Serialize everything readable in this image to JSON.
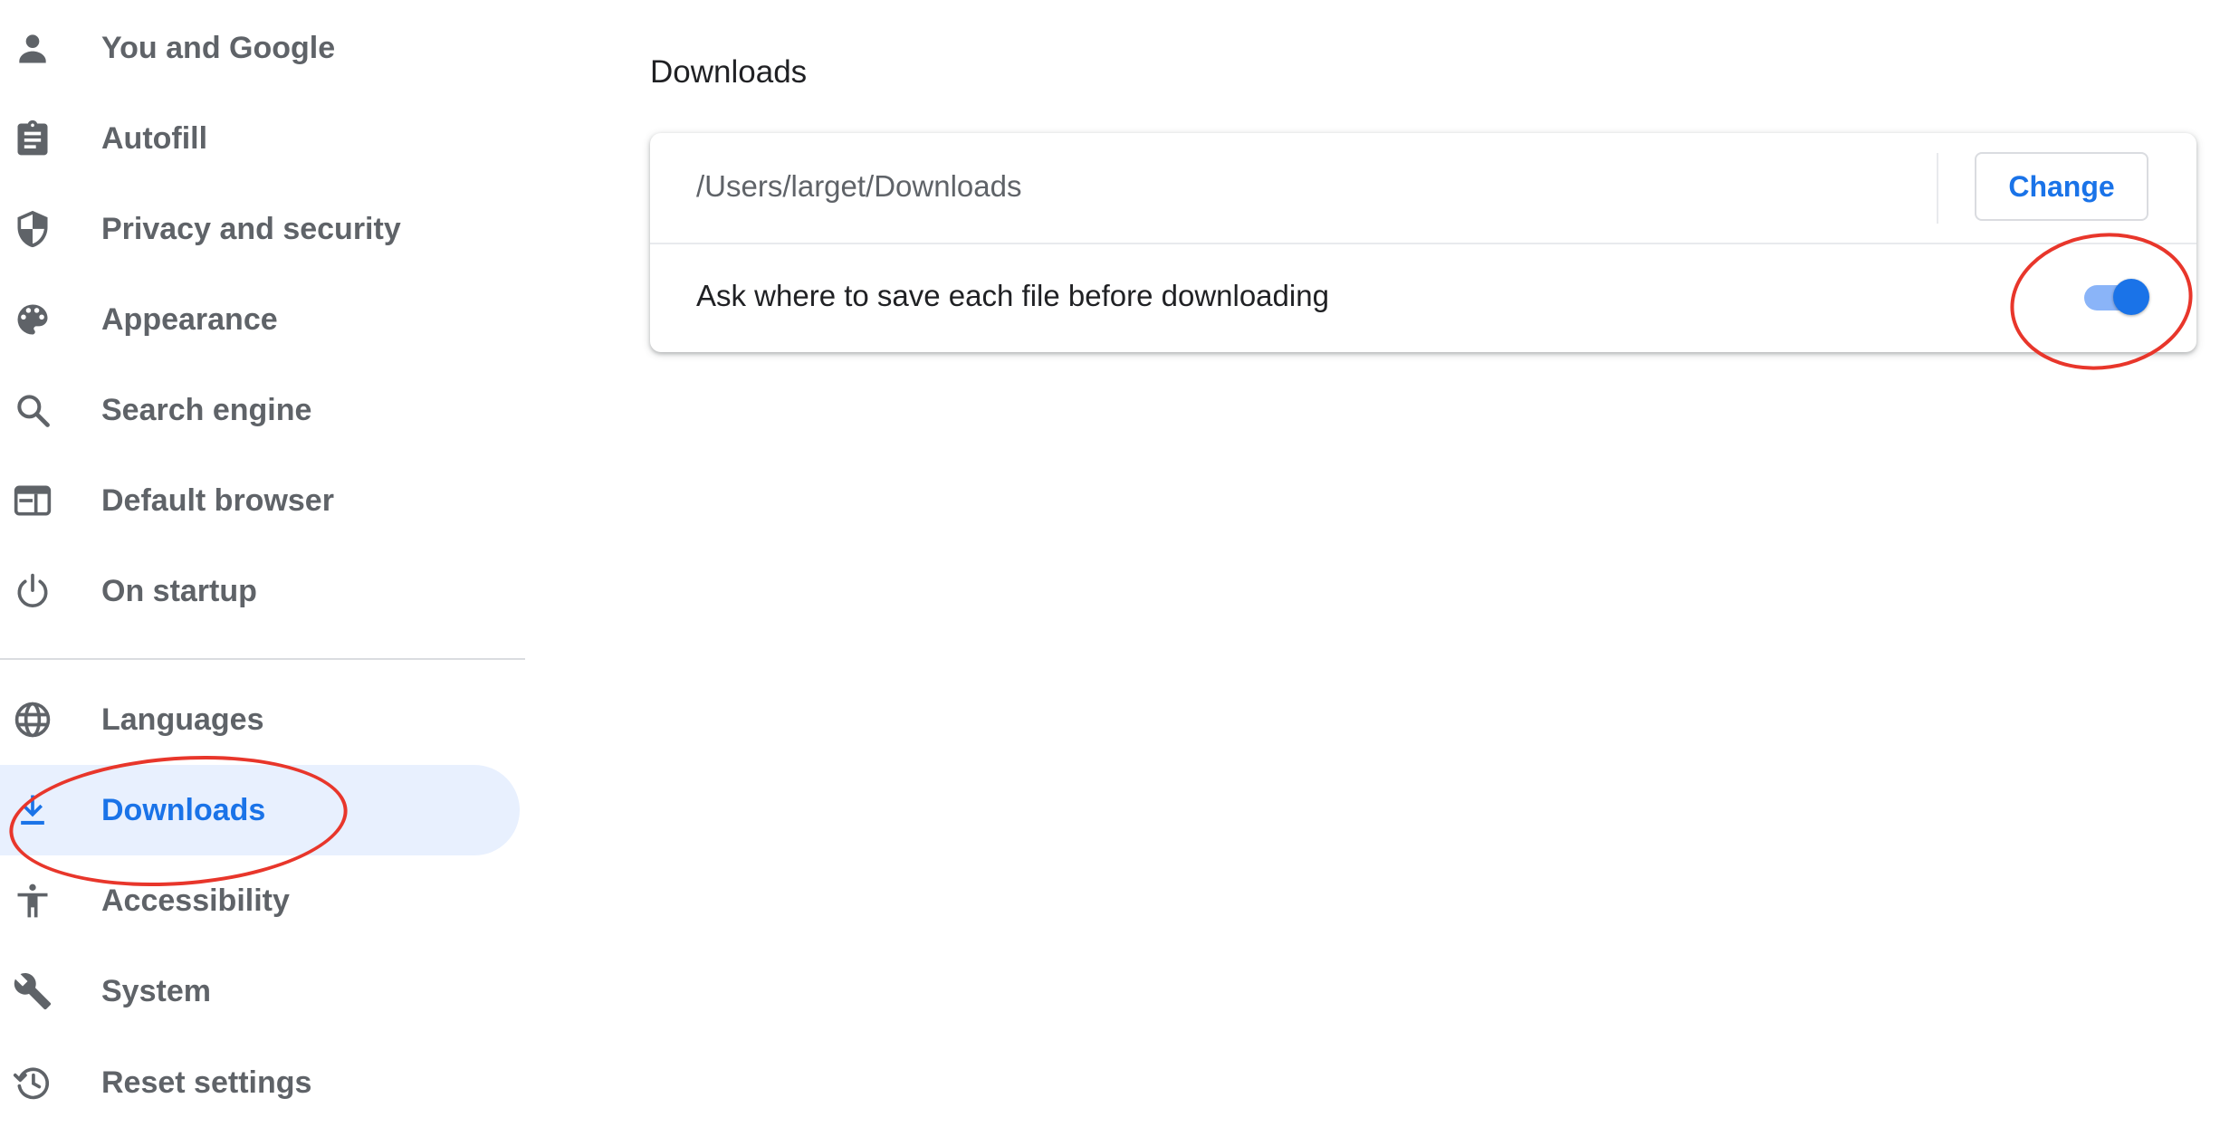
{
  "sidebar": {
    "items": [
      {
        "label": "You and Google",
        "icon": "person-icon"
      },
      {
        "label": "Autofill",
        "icon": "clipboard-icon"
      },
      {
        "label": "Privacy and security",
        "icon": "shield-icon"
      },
      {
        "label": "Appearance",
        "icon": "palette-icon"
      },
      {
        "label": "Search engine",
        "icon": "search-icon"
      },
      {
        "label": "Default browser",
        "icon": "browser-window-icon"
      },
      {
        "label": "On startup",
        "icon": "power-icon"
      },
      {
        "label": "Languages",
        "icon": "globe-icon"
      },
      {
        "label": "Downloads",
        "icon": "download-icon",
        "selected": true
      },
      {
        "label": "Accessibility",
        "icon": "accessibility-icon"
      },
      {
        "label": "System",
        "icon": "wrench-icon"
      },
      {
        "label": "Reset settings",
        "icon": "history-icon"
      }
    ]
  },
  "main": {
    "section_title": "Downloads",
    "location": {
      "path": "/Users/larget/Downloads",
      "change_label": "Change"
    },
    "ask_where": {
      "label": "Ask where to save each file before downloading",
      "enabled": true
    }
  },
  "colors": {
    "accent": "#1a73e8",
    "selected_bg": "#e8f0fe",
    "text_secondary": "#5f6368",
    "annotation": "#e8362b"
  }
}
